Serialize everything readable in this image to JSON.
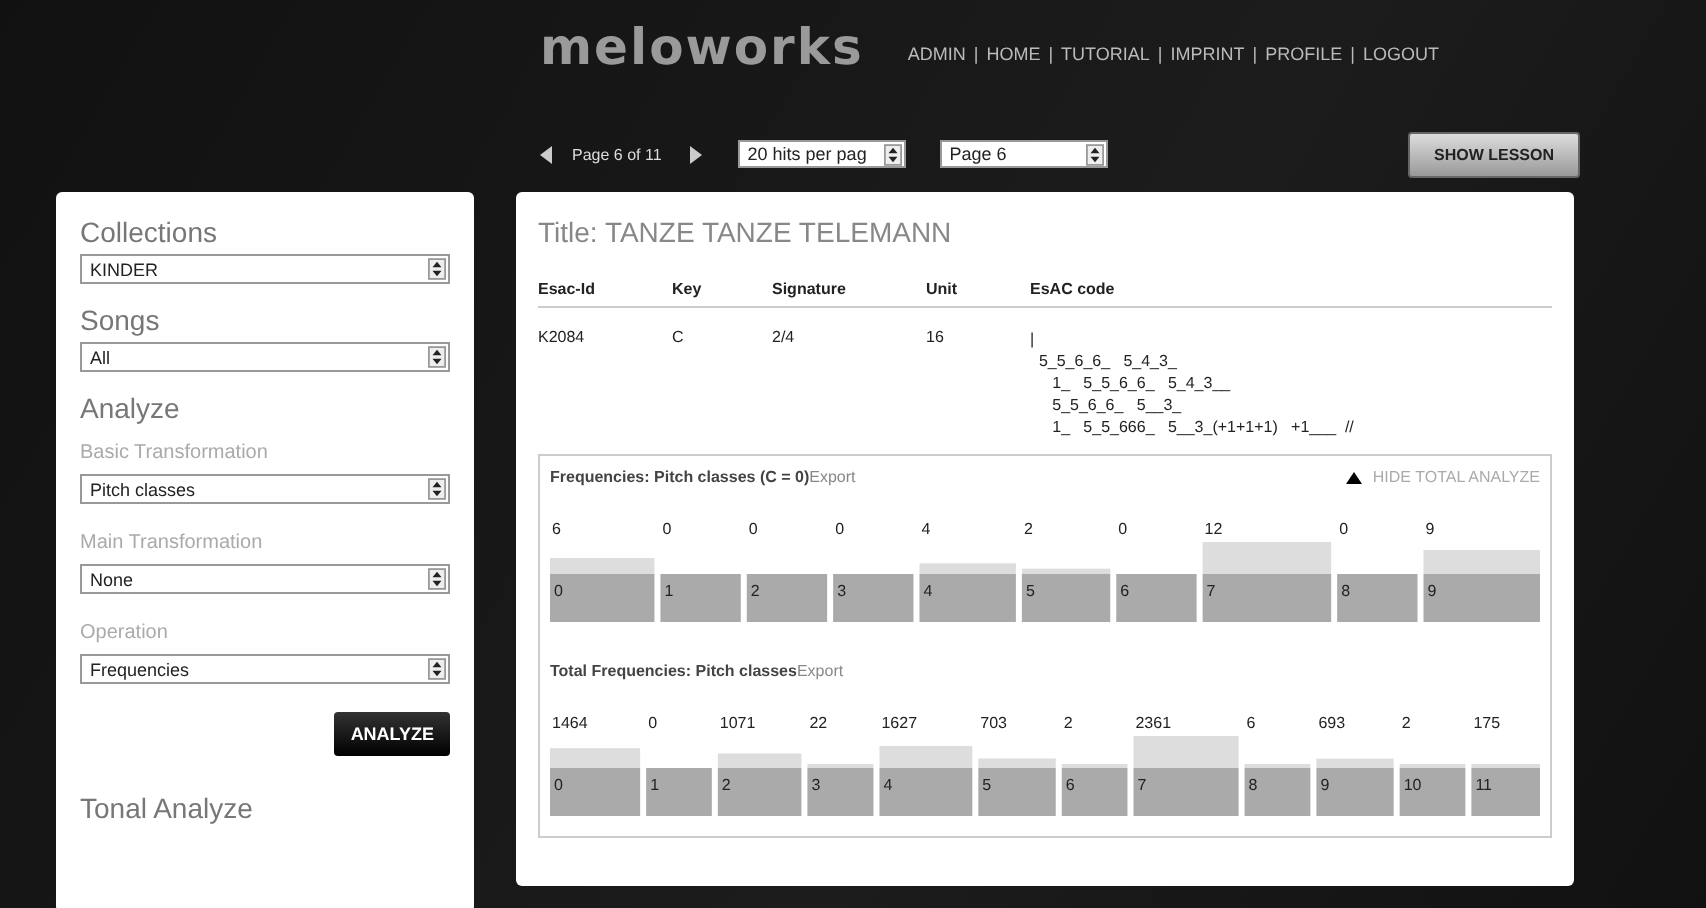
{
  "header": {
    "logo": "meloworks",
    "nav": [
      "ADMIN",
      "HOME",
      "TUTORIAL",
      "IMPRINT",
      "PROFILE",
      "LOGOUT"
    ],
    "separator": "|",
    "pager": {
      "text": "Page 6 of 11",
      "hits_select": "20 hits per pag",
      "page_select": "Page 6"
    },
    "show_lesson": "SHOW LESSON"
  },
  "sidebar": {
    "sections": [
      {
        "kind": "heading",
        "text": "Collections"
      },
      {
        "kind": "select",
        "value": "KINDER"
      },
      {
        "kind": "heading",
        "text": "Songs"
      },
      {
        "kind": "select",
        "value": "All"
      },
      {
        "kind": "heading",
        "text": "Analyze"
      },
      {
        "kind": "label",
        "text": "Basic Transformation"
      },
      {
        "kind": "select",
        "value": "Pitch classes"
      },
      {
        "kind": "label",
        "text": "Main Transformation"
      },
      {
        "kind": "select",
        "value": "None"
      },
      {
        "kind": "label",
        "text": "Operation"
      },
      {
        "kind": "select",
        "value": "Frequencies"
      },
      {
        "kind": "button",
        "text": "ANALYZE"
      },
      {
        "kind": "heading",
        "text": "Tonal Analyze"
      }
    ]
  },
  "song": {
    "title": "Title: TANZE TANZE TELEMANN",
    "table": {
      "columns": [
        "Esac-Id",
        "Key",
        "Signature",
        "Unit",
        "EsAC code"
      ],
      "row": [
        "K2084",
        "C",
        "2/4",
        "16"
      ],
      "esac_lines": [
        "|",
        "  5_5_6_6_   5_4_3_",
        "     1_   5_5_6_6_   5_4_3__",
        "     5_5_6_6_   5__3_",
        "     1_   5_5_666_   5__3_(+1+1+1)   +1___  //"
      ]
    }
  },
  "analysis": {
    "hide_link": "HIDE TOTAL ANALYZE",
    "blocks": [
      {
        "export": "Export",
        "chart_data": {
          "type": "bar",
          "title": "Frequencies: Pitch classes (C = 0)",
          "categories": [
            "0",
            "1",
            "2",
            "3",
            "4",
            "5",
            "6",
            "7",
            "8",
            "9"
          ],
          "values": [
            6,
            0,
            0,
            0,
            4,
            2,
            0,
            12,
            0,
            9
          ],
          "data_labels": true
        }
      },
      {
        "export": "Export",
        "chart_data": {
          "type": "bar",
          "title": "Total Frequencies: Pitch classes",
          "categories": [
            "0",
            "1",
            "2",
            "3",
            "4",
            "5",
            "6",
            "7",
            "8",
            "9",
            "10",
            "11"
          ],
          "values": [
            1464,
            0,
            1071,
            22,
            1627,
            703,
            2,
            2361,
            6,
            693,
            2,
            175
          ],
          "data_labels": true
        }
      }
    ]
  }
}
